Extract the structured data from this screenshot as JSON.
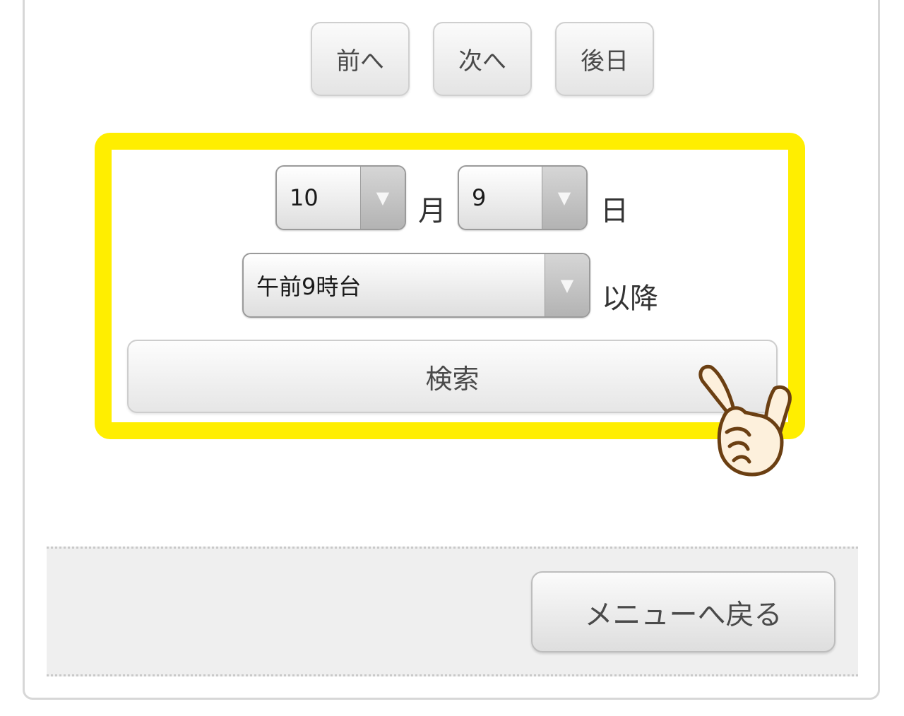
{
  "nav": {
    "prev_label": "前へ",
    "next_label": "次へ",
    "later_label": "後日"
  },
  "search_form": {
    "month_value": "10",
    "month_unit": "月",
    "day_value": "9",
    "day_unit": "日",
    "time_value": "午前9時台",
    "time_suffix": "以降",
    "search_label": "検索"
  },
  "footer": {
    "back_label": "メニューへ戻る"
  },
  "colors": {
    "highlight": "#ffee00",
    "footer_bg": "#efefef"
  },
  "icons": {
    "dropdown": "chevron-down-icon",
    "pointer": "pointing-hand-icon"
  }
}
